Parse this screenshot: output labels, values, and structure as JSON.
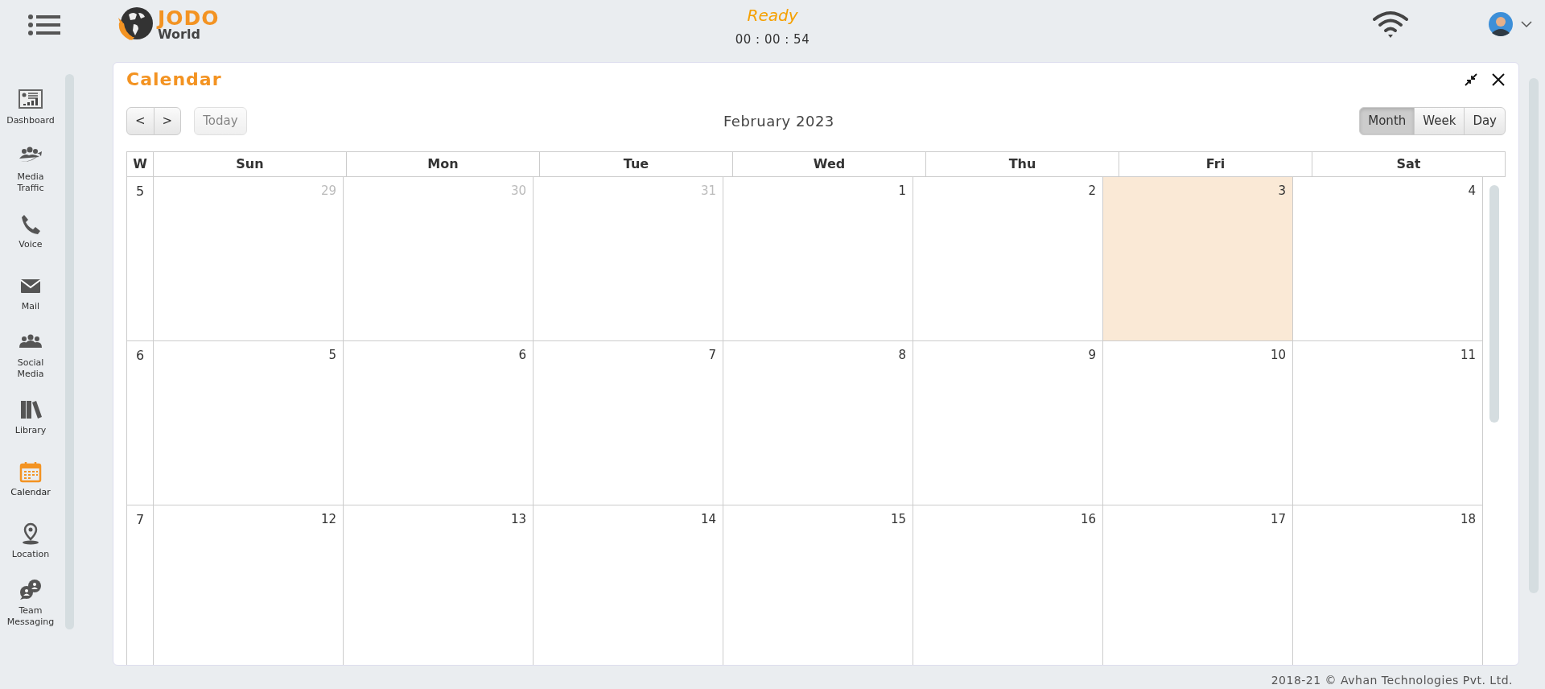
{
  "header": {
    "status": "Ready",
    "timer": "00 : 00 : 54",
    "brand_top": "JODO",
    "brand_bottom": "World"
  },
  "sidebar": {
    "items": [
      {
        "label": "Dashboard",
        "selected": false
      },
      {
        "label": "Media Traffic",
        "selected": false
      },
      {
        "label": "Voice",
        "selected": false
      },
      {
        "label": "Mail",
        "selected": false
      },
      {
        "label": "Social Media",
        "selected": false
      },
      {
        "label": "Library",
        "selected": false
      },
      {
        "label": "Calendar",
        "selected": true
      },
      {
        "label": "Location",
        "selected": false
      },
      {
        "label": "Team Messaging",
        "selected": false
      }
    ]
  },
  "calendar": {
    "title": "Calendar",
    "prev": "<",
    "next": ">",
    "today_button": {
      "label": "Today",
      "disabled": true
    },
    "month_title": "February 2023",
    "views": [
      {
        "label": "Month",
        "selected": true
      },
      {
        "label": "Week",
        "selected": false
      },
      {
        "label": "Day",
        "selected": false
      }
    ],
    "week_header": "W",
    "weekdays": [
      "Sun",
      "Mon",
      "Tue",
      "Wed",
      "Thu",
      "Fri",
      "Sat"
    ],
    "weeks": [
      {
        "week": "5",
        "days": [
          {
            "day": "29",
            "other_month": true,
            "today": false
          },
          {
            "day": "30",
            "other_month": true,
            "today": false
          },
          {
            "day": "31",
            "other_month": true,
            "today": false
          },
          {
            "day": "1",
            "other_month": false,
            "today": false
          },
          {
            "day": "2",
            "other_month": false,
            "today": false
          },
          {
            "day": "3",
            "other_month": false,
            "today": true
          },
          {
            "day": "4",
            "other_month": false,
            "today": false
          }
        ]
      },
      {
        "week": "6",
        "days": [
          {
            "day": "5",
            "other_month": false,
            "today": false
          },
          {
            "day": "6",
            "other_month": false,
            "today": false
          },
          {
            "day": "7",
            "other_month": false,
            "today": false
          },
          {
            "day": "8",
            "other_month": false,
            "today": false
          },
          {
            "day": "9",
            "other_month": false,
            "today": false
          },
          {
            "day": "10",
            "other_month": false,
            "today": false
          },
          {
            "day": "11",
            "other_month": false,
            "today": false
          }
        ]
      },
      {
        "week": "7",
        "days": [
          {
            "day": "12",
            "other_month": false,
            "today": false
          },
          {
            "day": "13",
            "other_month": false,
            "today": false
          },
          {
            "day": "14",
            "other_month": false,
            "today": false
          },
          {
            "day": "15",
            "other_month": false,
            "today": false
          },
          {
            "day": "16",
            "other_month": false,
            "today": false
          },
          {
            "day": "17",
            "other_month": false,
            "today": false
          },
          {
            "day": "18",
            "other_month": false,
            "today": false
          }
        ]
      }
    ]
  },
  "footer": "2018-21 © Avhan Technologies Pvt. Ltd."
}
